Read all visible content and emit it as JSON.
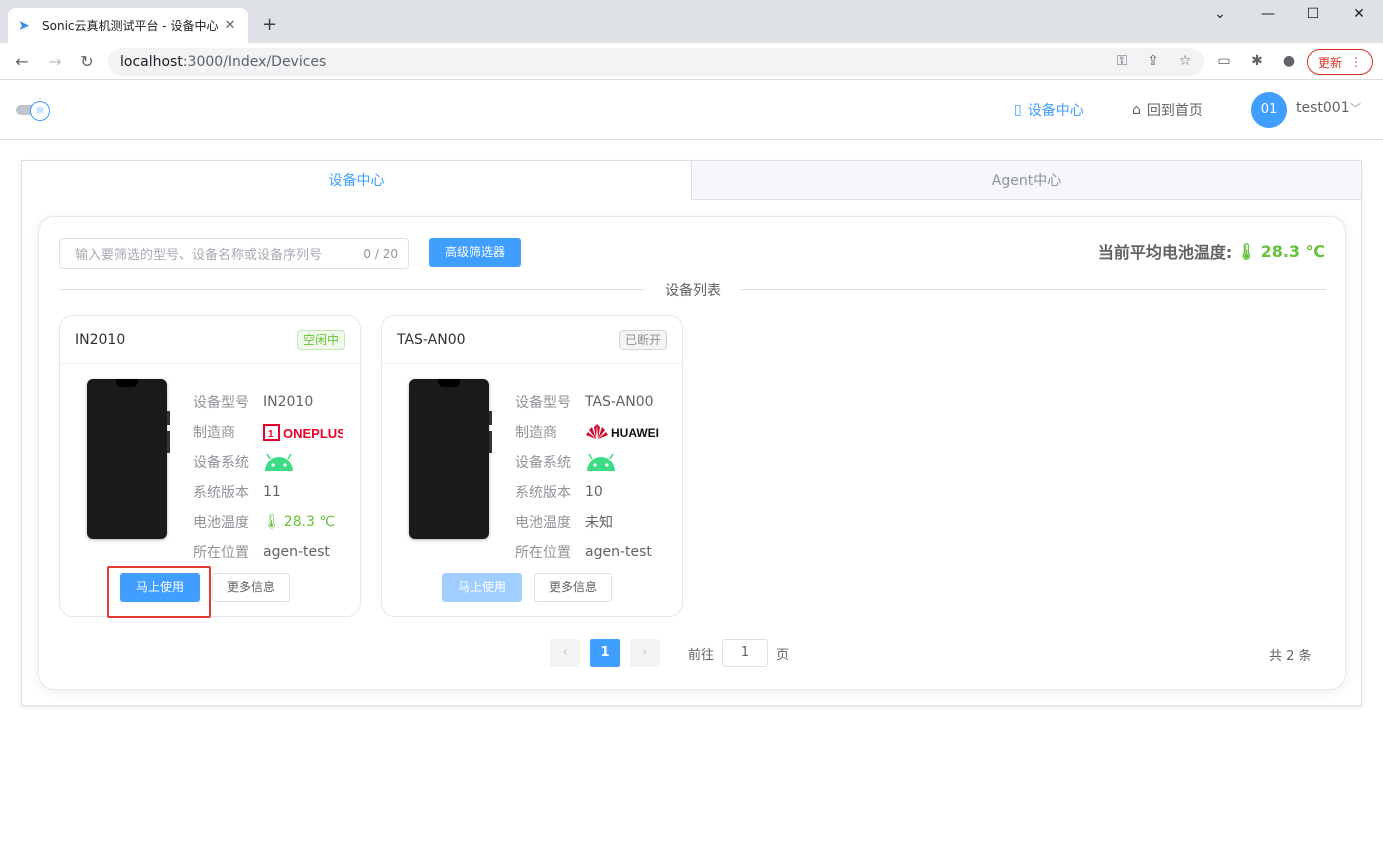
{
  "browser": {
    "tab_title": "Sonic云真机测试平台 - 设备中心",
    "url_host": "localhost",
    "url_path": ":3000/Index/Devices",
    "update_label": "更新"
  },
  "header": {
    "nav_devices": "设备中心",
    "nav_home": "回到首页",
    "avatar_text": "01",
    "username": "test001"
  },
  "tabs": [
    {
      "label": "设备中心"
    },
    {
      "label": "Agent中心"
    }
  ],
  "toolbar": {
    "search_placeholder": "输入要筛选的型号、设备名称或设备序列号",
    "search_count": "0 / 20",
    "advanced_filter": "高级筛选器",
    "avg_temp_label": "当前平均电池温度:",
    "avg_temp_value": "28.3 ℃"
  },
  "divider_label": "设备列表",
  "field_labels": {
    "model": "设备型号",
    "maker": "制造商",
    "system": "设备系统",
    "version": "系统版本",
    "battery": "电池温度",
    "location": "所在位置"
  },
  "devices": [
    {
      "name": "IN2010",
      "status": "空闲中",
      "model": "IN2010",
      "maker_logo": "ONEPLUS",
      "system_icon": "android-icon",
      "version": "11",
      "battery": "28.3 ℃",
      "location": "agen-test",
      "use_label": "马上使用",
      "more_label": "更多信息"
    },
    {
      "name": "TAS-AN00",
      "status": "已断开",
      "model": "TAS-AN00",
      "maker_logo": "HUAWEI",
      "system_icon": "android-icon",
      "version": "10",
      "battery": "未知",
      "location": "agen-test",
      "use_label": "马上使用",
      "more_label": "更多信息"
    }
  ],
  "pagination": {
    "current": "1",
    "goto_prefix": "前往",
    "goto_value": "1",
    "goto_suffix": "页",
    "total": "共 2 条"
  },
  "colors": {
    "primary": "#409eff",
    "success": "#67c23a",
    "highlight": "#e53935"
  }
}
